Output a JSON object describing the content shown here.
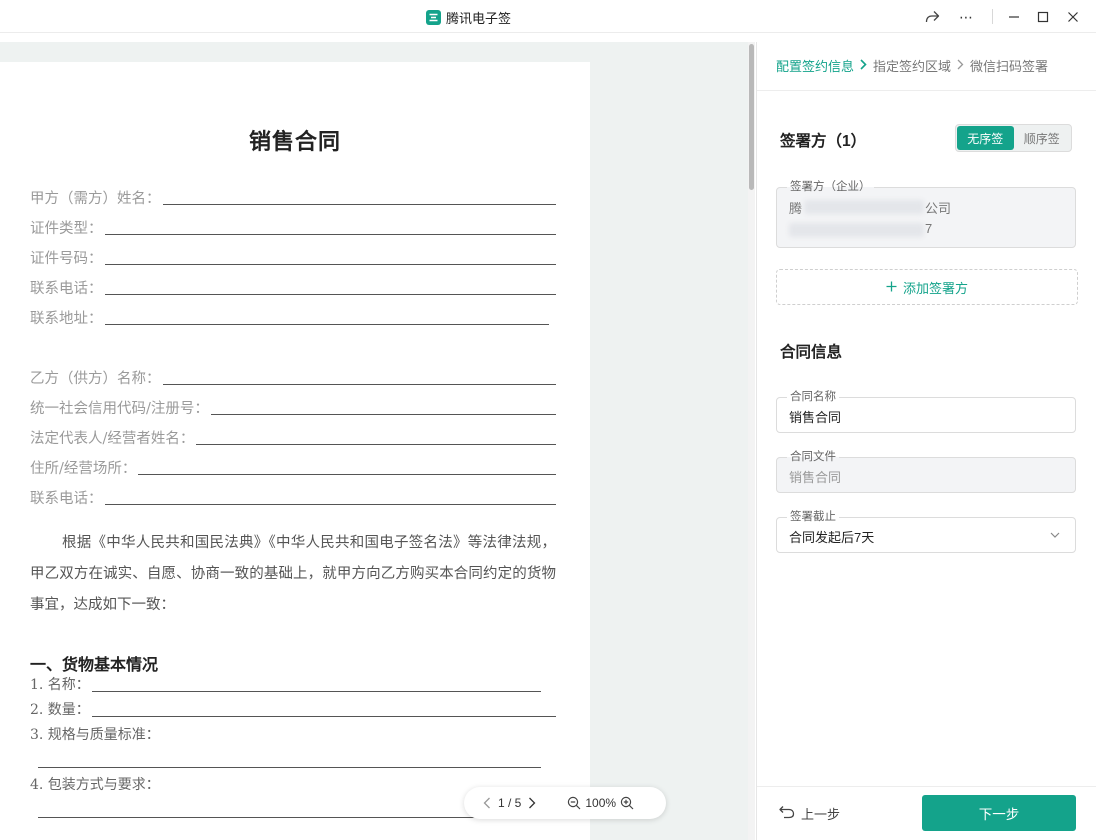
{
  "app": {
    "title": "腾讯电子签"
  },
  "window": {
    "share": "share",
    "more": "⋯",
    "minimize": "—",
    "maximize": "☐",
    "close": "✕"
  },
  "document": {
    "title": "销售合同",
    "party_a": [
      "甲方（需方）姓名：",
      "证件类型：",
      "证件号码：",
      "联系电话：",
      "联系地址："
    ],
    "party_b": [
      "乙方（供方）名称：",
      "统一社会信用代码/注册号：",
      "法定代表人/经营者姓名：",
      "住所/经营场所：",
      "联系电话："
    ],
    "intro": "根据《中华人民共和国民法典》《中华人民共和国电子签名法》等法律法规，甲乙双方在诚实、自愿、协商一致的基础上，就甲方向乙方购买本合同约定的货物事宜，达成如下一致：",
    "section1": "一、货物基本情况",
    "items": [
      "1. 名称：",
      "2. 数量：",
      "3. 规格与质量标准：",
      "4. 包装方式与要求："
    ]
  },
  "pager": {
    "page": "1 / 5",
    "zoom": "100%"
  },
  "panel": {
    "steps": [
      "配置签约信息",
      "指定签约区域",
      "微信扫码签署"
    ],
    "signer_title": "签署方（1）",
    "order_options": [
      "无序签",
      "顺序签"
    ],
    "party": {
      "label": "签署方（企业）",
      "line1_start": "腾",
      "line1_end": "公司",
      "line2_end": "7"
    },
    "add_party": "添加签署方",
    "contract_title": "合同信息",
    "contract_name_label": "合同名称",
    "contract_name_value": "销售合同",
    "contract_file_label": "合同文件",
    "contract_file_value": "销售合同",
    "deadline_label": "签署截止",
    "deadline_value": "合同发起后7天",
    "prev": "上一步",
    "next": "下一步"
  },
  "colors": {
    "accent": "#14a38b",
    "doc_bg": "#eef2f1"
  }
}
